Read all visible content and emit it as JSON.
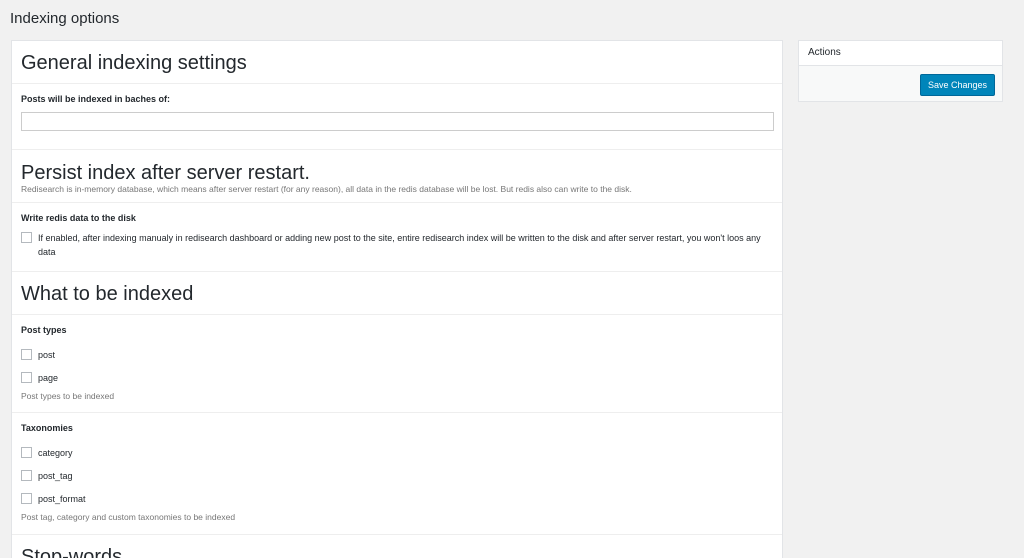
{
  "page_title": "Indexing options",
  "general": {
    "title": "General indexing settings",
    "batch_label": "Posts will be indexed in baches of:",
    "batch_value": ""
  },
  "persist": {
    "title": "Persist index after server restart.",
    "description": "Redisearch is in-memory database, which means after server restart (for any reason), all data in the redis database will be lost. But redis also can write to the disk.",
    "write_label": "Write redis data to the disk",
    "write_checkbox_text": "If enabled, after indexing manualy in redisearch dashboard or adding new post to the site, entire redisearch index will be written to the disk and after server restart, you won't loos any data"
  },
  "what": {
    "title": "What to be indexed",
    "post_types_label": "Post types",
    "post_types": [
      "post",
      "page"
    ],
    "post_types_help": "Post types to be indexed",
    "taxonomies_label": "Taxonomies",
    "taxonomies": [
      "category",
      "post_tag",
      "post_format"
    ],
    "taxonomies_help": "Post tag, category and custom taxonomies to be indexed"
  },
  "stopwords": {
    "title": "Stop-words"
  },
  "actions": {
    "title": "Actions",
    "save_label": "Save Changes"
  }
}
